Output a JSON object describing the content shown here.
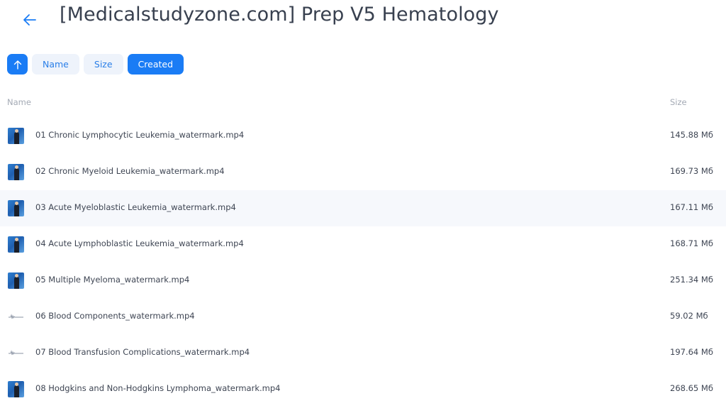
{
  "header": {
    "back_icon": "arrow-left-icon",
    "title": "[Medicalstudyzone.com] Prep V5 Hematology"
  },
  "sort": {
    "direction_icon": "arrow-up-icon",
    "options": [
      "Name",
      "Size",
      "Created"
    ],
    "active": "Created"
  },
  "columns": {
    "name": "Name",
    "size": "Size"
  },
  "files": [
    {
      "name": "01 Chronic Lymphocytic Leukemia_watermark.mp4",
      "size": "145.88 Мб",
      "thumb": "video"
    },
    {
      "name": "02 Chronic Myeloid Leukemia_watermark.mp4",
      "size": "169.73 Мб",
      "thumb": "video"
    },
    {
      "name": "03 Acute Myeloblastic Leukemia_watermark.mp4",
      "size": "167.11 Мб",
      "thumb": "video"
    },
    {
      "name": "04 Acute Lymphoblastic Leukemia_watermark.mp4",
      "size": "168.71 Мб",
      "thumb": "video"
    },
    {
      "name": "05 Multiple Myeloma_watermark.mp4",
      "size": "251.34 Мб",
      "thumb": "video"
    },
    {
      "name": "06 Blood Components_watermark.mp4",
      "size": "59.02 Мб",
      "thumb": "audio"
    },
    {
      "name": "07 Blood Transfusion Complications_watermark.mp4",
      "size": "197.64 Мб",
      "thumb": "audio"
    },
    {
      "name": "08 Hodgkins and Non-Hodgkins Lymphoma_watermark.mp4",
      "size": "268.65 Мб",
      "thumb": "video"
    }
  ],
  "colors": {
    "accent": "#1a7cf5",
    "hover_row": "#f6f8fc"
  }
}
